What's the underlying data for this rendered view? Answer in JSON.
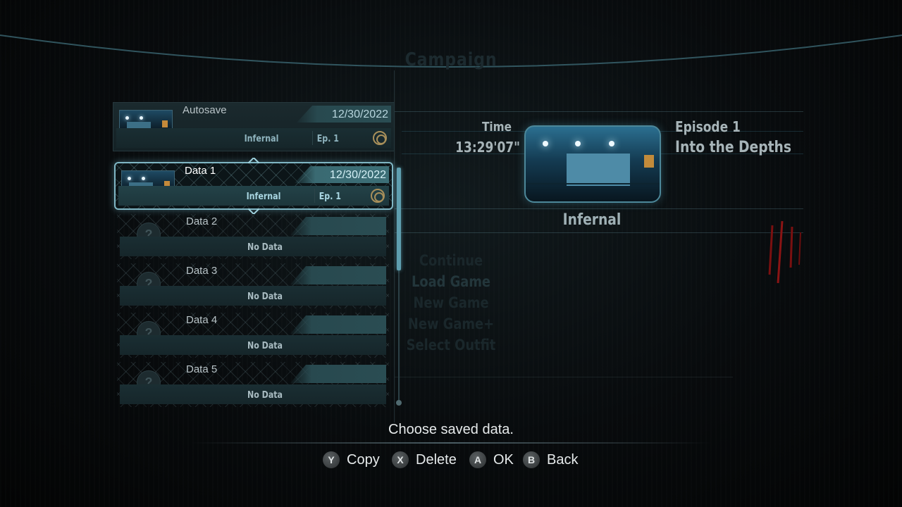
{
  "header": {
    "title": "Campaign"
  },
  "save_list": {
    "autosave": {
      "label": "Autosave",
      "date": "12/30/2022",
      "difficulty": "Infernal",
      "episode": "Ep. 1"
    },
    "slots": [
      {
        "label": "Data 1",
        "date": "12/30/2022",
        "difficulty": "Infernal",
        "episode": "Ep. 1",
        "selected": true
      },
      {
        "label": "Data 2",
        "status": "No Data",
        "icon": "?"
      },
      {
        "label": "Data 3",
        "status": "No Data",
        "icon": "?"
      },
      {
        "label": "Data 4",
        "status": "No Data",
        "icon": "?"
      },
      {
        "label": "Data 5",
        "status": "No Data",
        "icon": "?"
      }
    ]
  },
  "detail": {
    "time_label": "Time",
    "time": "13:29'07\"",
    "episode": "Episode 1",
    "chapter": "Into the Depths",
    "difficulty": "Infernal"
  },
  "background_menu": [
    "Continue",
    "Load Game",
    "New Game",
    "New Game+",
    "Select Outfit"
  ],
  "footer": {
    "prompt": "Choose saved data.",
    "buttons": [
      {
        "glyph": "Y",
        "label": "Copy"
      },
      {
        "glyph": "X",
        "label": "Delete"
      },
      {
        "glyph": "A",
        "label": "OK"
      },
      {
        "glyph": "B",
        "label": "Back"
      }
    ]
  },
  "colors": {
    "accent": "#7fb6c4",
    "panel": "#1b2a2e",
    "text": "#e6eaeb",
    "claw": "#8a1414"
  }
}
